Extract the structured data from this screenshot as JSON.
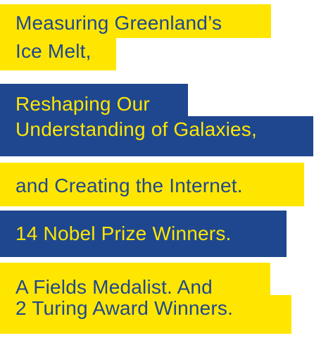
{
  "blocks": [
    {
      "id": "greenland",
      "style": "yellow",
      "lines": [
        "Measuring Greenland’s",
        "Ice Melt,"
      ]
    },
    {
      "id": "galaxies",
      "style": "blue",
      "lines": [
        "Reshaping Our",
        "Understanding of Galaxies,"
      ]
    },
    {
      "id": "internet",
      "style": "yellow",
      "lines": [
        "and Creating the Internet."
      ]
    },
    {
      "id": "nobel",
      "style": "blue",
      "lines": [
        "14 Nobel Prize Winners."
      ]
    },
    {
      "id": "fields-turing",
      "style": "yellow",
      "lines": [
        "A Fields Medalist. And",
        "2 Turing Award Winners."
      ]
    }
  ],
  "colors": {
    "yellow": "#ffe600",
    "blue": "#1f4790"
  }
}
